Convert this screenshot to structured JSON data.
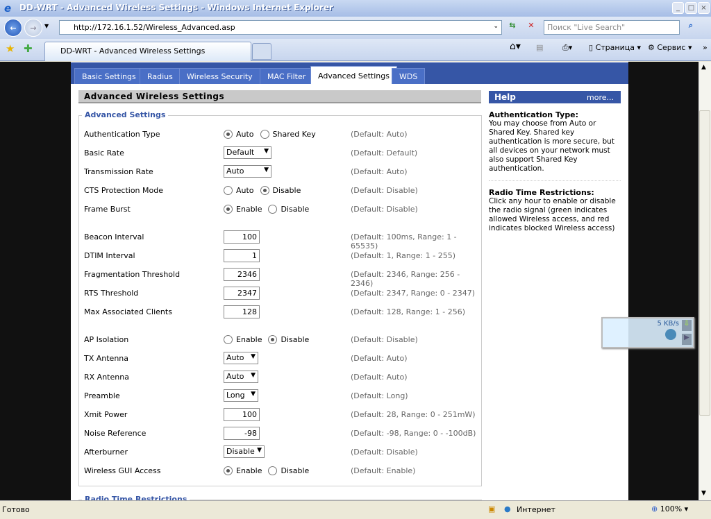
{
  "window": {
    "title": "DD-WRT - Advanced Wireless Settings - Windows Internet Explorer"
  },
  "browser": {
    "address": "http://172.16.1.52/Wireless_Advanced.asp",
    "search_placeholder": "Поиск \"Live Search\"",
    "tab_title": "DD-WRT - Advanced Wireless Settings",
    "page_menu": "Страница",
    "tools_menu": "Сервис",
    "status": "Готово",
    "zone": "Интернет",
    "zoom": "100%"
  },
  "tabs": [
    "Basic Settings",
    "Radius",
    "Wireless Security",
    "MAC Filter",
    "Advanced Settings",
    "WDS"
  ],
  "active_tab": 4,
  "section_title": "Advanced Wireless Settings",
  "fieldset_legend": "Advanced Settings",
  "next_legend": "Radio Time Restrictions",
  "rows": [
    {
      "label": "Authentication Type",
      "type": "radio",
      "options": [
        "Auto",
        "Shared Key"
      ],
      "selected": 0,
      "default": "(Default: Auto)"
    },
    {
      "label": "Basic Rate",
      "type": "select",
      "value": "Default",
      "default": "(Default: Default)"
    },
    {
      "label": "Transmission Rate",
      "type": "select",
      "value": "Auto",
      "default": "(Default: Auto)"
    },
    {
      "label": "CTS Protection Mode",
      "type": "radio",
      "options": [
        "Auto",
        "Disable"
      ],
      "selected": 1,
      "default": "(Default: Disable)"
    },
    {
      "label": "Frame Burst",
      "type": "radio",
      "options": [
        "Enable",
        "Disable"
      ],
      "selected": 0,
      "default": "(Default: Disable)"
    },
    {
      "label": "Beacon Interval",
      "type": "input",
      "value": "100",
      "default": "(Default: 100ms, Range: 1 - 65535)"
    },
    {
      "label": "DTIM Interval",
      "type": "input",
      "value": "1",
      "default": "(Default: 1, Range: 1 - 255)"
    },
    {
      "label": "Fragmentation Threshold",
      "type": "input",
      "value": "2346",
      "default": "(Default: 2346, Range: 256 - 2346)"
    },
    {
      "label": "RTS Threshold",
      "type": "input",
      "value": "2347",
      "default": "(Default: 2347, Range: 0 - 2347)"
    },
    {
      "label": "Max Associated Clients",
      "type": "input",
      "value": "128",
      "default": "(Default: 128, Range: 1 - 256)"
    },
    {
      "label": "AP Isolation",
      "type": "radio",
      "options": [
        "Enable",
        "Disable"
      ],
      "selected": 1,
      "default": "(Default: Disable)"
    },
    {
      "label": "TX Antenna",
      "type": "select",
      "value": "Auto",
      "default": "(Default: Auto)"
    },
    {
      "label": "RX Antenna",
      "type": "select",
      "value": "Auto",
      "default": "(Default: Auto)"
    },
    {
      "label": "Preamble",
      "type": "select",
      "value": "Long",
      "default": "(Default: Long)"
    },
    {
      "label": "Xmit Power",
      "type": "input",
      "value": "100",
      "default": "(Default: 28, Range: 0 - 251mW)"
    },
    {
      "label": "Noise Reference",
      "type": "input",
      "value": "-98",
      "default": "(Default: -98, Range: 0 - -100dB)"
    },
    {
      "label": "Afterburner",
      "type": "select",
      "value": "Disable",
      "default": "(Default: Disable)"
    },
    {
      "label": "Wireless GUI Access",
      "type": "radio",
      "options": [
        "Enable",
        "Disable"
      ],
      "selected": 0,
      "default": "(Default: Enable)"
    }
  ],
  "help": {
    "title": "Help",
    "more": "more...",
    "sections": [
      {
        "heading": "Authentication Type:",
        "text": "You may choose from Auto or Shared Key. Shared key authentication is more secure, but all devices on your network must also support Shared Key authentication."
      },
      {
        "heading": "Radio Time Restrictions:",
        "text": "Click any hour to enable or disable the radio signal (green indicates allowed Wireless access, and red indicates blocked Wireless access)"
      }
    ]
  },
  "widget": {
    "speed": "5 KB/s"
  }
}
